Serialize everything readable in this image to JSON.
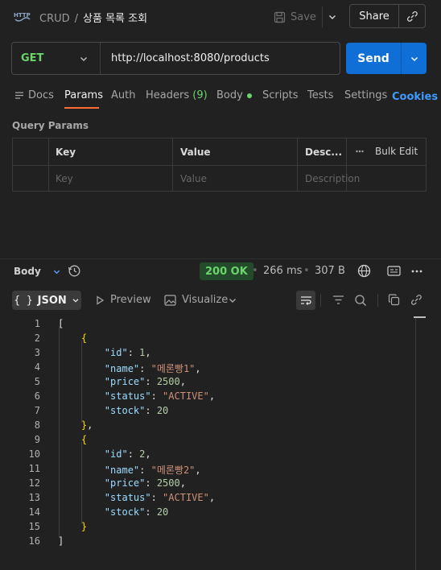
{
  "header": {
    "badge": "HTTP",
    "collection": "CRUD",
    "separator": "/",
    "request_name": "상품 목록 조회",
    "save_label": "Save",
    "share_label": "Share"
  },
  "request": {
    "method": "GET",
    "url": "http://localhost:8080/products",
    "send_label": "Send"
  },
  "tabs": {
    "docs": "Docs",
    "params": "Params",
    "auth": "Auth",
    "headers": "Headers",
    "headers_count": "(9)",
    "body": "Body",
    "scripts": "Scripts",
    "tests": "Tests",
    "settings": "Settings",
    "cookies": "Cookies",
    "active": "Params"
  },
  "query_params": {
    "title": "Query Params",
    "columns": {
      "key": "Key",
      "value": "Value",
      "description": "Desc...",
      "bulk_edit": "Bulk Edit"
    },
    "placeholders": {
      "key": "Key",
      "value": "Value",
      "description": "Description"
    }
  },
  "response": {
    "body_label": "Body",
    "status": "200 OK",
    "time": "266 ms",
    "size": "307 B",
    "format": "JSON",
    "preview_label": "Preview",
    "visualize_label": "Visualize"
  },
  "code_lines": [
    "1",
    "2",
    "3",
    "4",
    "5",
    "6",
    "7",
    "8",
    "9",
    "10",
    "11",
    "12",
    "13",
    "14",
    "15",
    "16"
  ],
  "products": [
    {
      "id": "1",
      "name": "\"메론빵1\"",
      "price": "2500",
      "status": "\"ACTIVE\"",
      "stock": "20"
    },
    {
      "id": "2",
      "name": "\"메론빵2\"",
      "price": "2500",
      "status": "\"ACTIVE\"",
      "stock": "20"
    }
  ],
  "json_keys": {
    "id": "\"id\"",
    "name": "\"name\"",
    "price": "\"price\"",
    "status": "\"status\"",
    "stock": "\"stock\""
  },
  "colors": {
    "accent": "#0f6fd6",
    "success": "#6bd46b",
    "tab_underline": "#ff6c37",
    "link": "#3d9bff"
  }
}
